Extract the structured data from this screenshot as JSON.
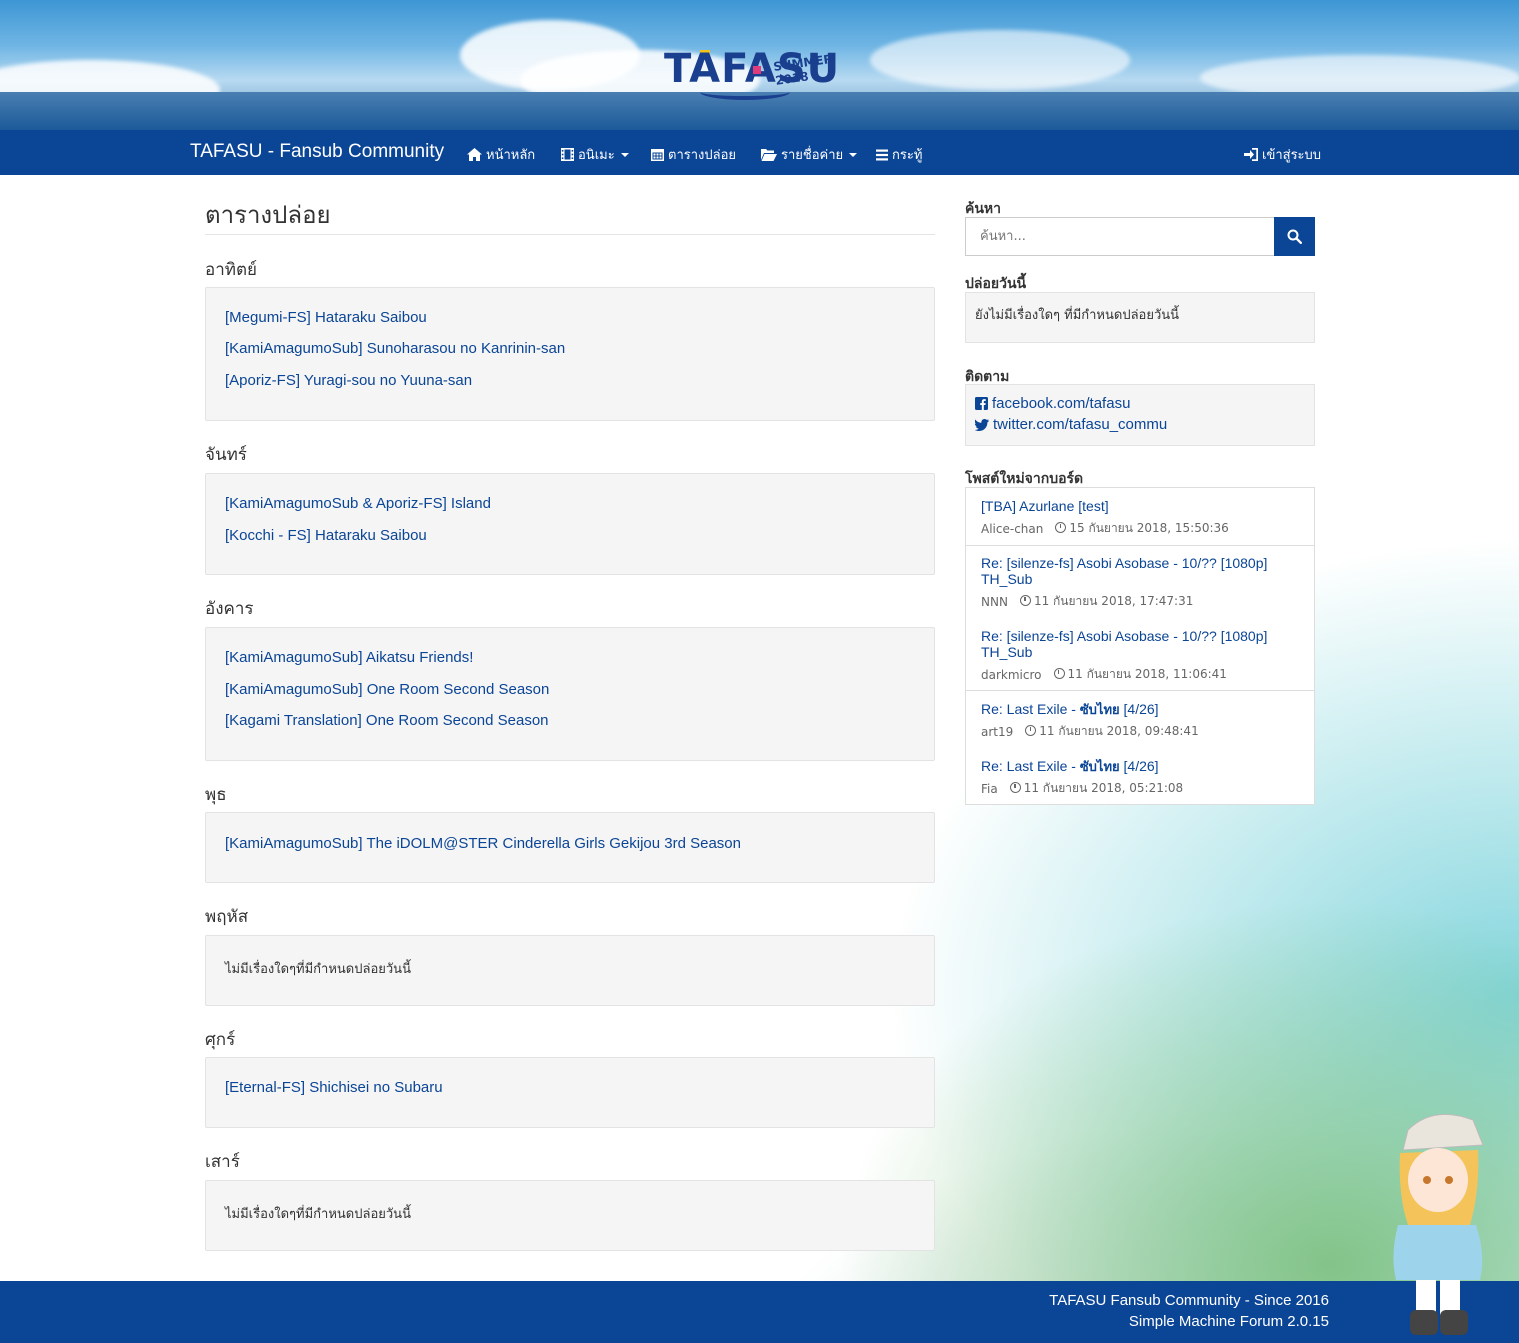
{
  "header": {
    "logo_text": "TAFASU",
    "logo_sub": "SUMMER 2018"
  },
  "navbar": {
    "brand": "TAFASU - Fansub Community",
    "items": [
      {
        "label": "หน้าหลัก",
        "icon": "home-icon",
        "dropdown": false
      },
      {
        "label": "อนิเมะ",
        "icon": "film-icon",
        "dropdown": true
      },
      {
        "label": "ตารางปล่อย",
        "icon": "calendar-icon",
        "dropdown": false
      },
      {
        "label": "รายชื่อค่าย",
        "icon": "folder-open-icon",
        "dropdown": true
      },
      {
        "label": "กระทู้",
        "icon": "list-icon",
        "dropdown": false
      }
    ],
    "login": "เข้าสู่ระบบ"
  },
  "main": {
    "title": "ตารางปล่อย",
    "days": [
      {
        "name": "อาทิตย์",
        "items": [
          "[Megumi-FS] Hataraku Saibou",
          "[KamiAmagumoSub] Sunoharasou no Kanrinin-san",
          "[Aporiz-FS] Yuragi-sou no Yuuna-san"
        ]
      },
      {
        "name": "จันทร์",
        "items": [
          "[KamiAmagumoSub & Aporiz-FS] Island",
          "[Kocchi - FS] Hataraku Saibou"
        ]
      },
      {
        "name": "อังคาร",
        "items": [
          "[KamiAmagumoSub] Aikatsu Friends!",
          "[KamiAmagumoSub] One Room Second Season",
          "[Kagami Translation] One Room Second Season"
        ]
      },
      {
        "name": "พุธ",
        "items": [
          "[KamiAmagumoSub] The iDOLM@STER Cinderella Girls Gekijou 3rd Season"
        ]
      },
      {
        "name": "พฤหัส",
        "empty": "ไม่มีเรื่องใดๆที่มีกำหนดปล่อยวันนี้"
      },
      {
        "name": "ศุกร์",
        "items": [
          "[Eternal-FS] Shichisei no Subaru"
        ]
      },
      {
        "name": "เสาร์",
        "empty": "ไม่มีเรื่องใดๆที่มีกำหนดปล่อยวันนี้"
      }
    ]
  },
  "sidebar": {
    "search_heading": "ค้นหา",
    "search_placeholder": "ค้นหา...",
    "today_heading": "ปล่อยวันนี้",
    "today_text": "ยังไม่มีเรื่องใดๆ ที่มีกำหนดปล่อยวันนี้",
    "follow_heading": "ติดตาม",
    "facebook": "facebook.com/tafasu",
    "twitter": "twitter.com/tafasu_commu",
    "posts_heading": "โพสต์ใหม่จากบอร์ด",
    "posts": [
      {
        "title": "[TBA] Azurlane [test]",
        "user": "Alice-chan",
        "time": "15 กันยายน 2018, 15:50:36"
      },
      {
        "title": "Re: [silenze-fs] Asobi Asobase - 10/?? [1080p] TH_Sub",
        "user": "NNN",
        "time": "11 กันยายน 2018, 17:47:31"
      },
      {
        "title": "Re: [silenze-fs] Asobi Asobase - 10/?? [1080p] TH_Sub",
        "user": "darkmicro",
        "time": "11 กันยายน 2018, 11:06:41"
      },
      {
        "title_prefix": "Re: Last Exile - ",
        "title_bold": "ซับไทย",
        "title_suffix": " [4/26]",
        "user": "art19",
        "time": "11 กันยายน 2018, 09:48:41"
      },
      {
        "title_prefix": "Re: Last Exile - ",
        "title_bold": "ซับไทย",
        "title_suffix": " [4/26]",
        "user": "Fia",
        "time": "11 กันยายน 2018, 05:21:08"
      }
    ]
  },
  "footer": {
    "line1": "TAFASU Fansub Community - Since 2016",
    "line2": "Simple Machine Forum 2.0.15"
  }
}
